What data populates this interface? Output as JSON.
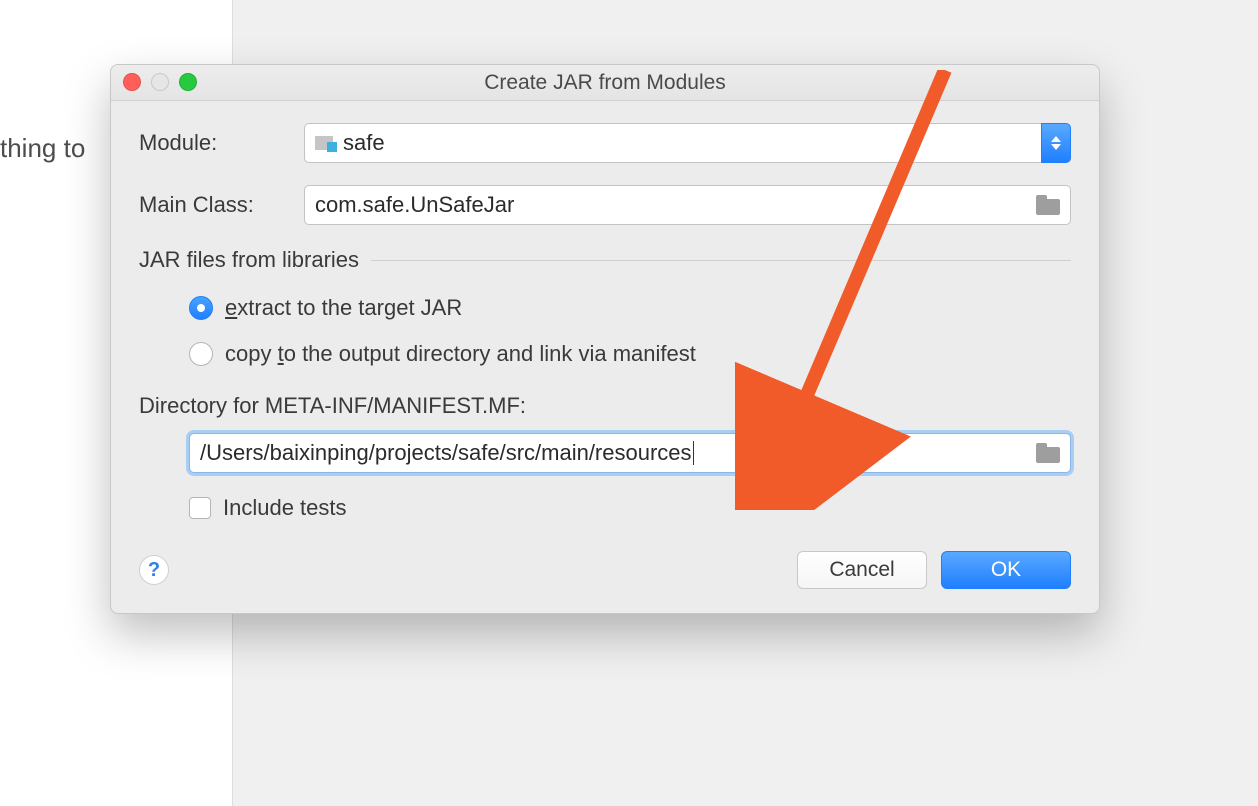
{
  "background": {
    "text_fragment": "thing to"
  },
  "dialog": {
    "title": "Create JAR from Modules",
    "module_label": "Module:",
    "module_value": "safe",
    "main_class_label": "Main Class:",
    "main_class_value": "com.safe.UnSafeJar",
    "group_title": "JAR files from libraries",
    "radio_extract": "extract to the target JAR",
    "radio_copy": "copy to the output directory and link via manifest",
    "dir_label": "Directory for META-INF/MANIFEST.MF:",
    "dir_value": "/Users/baixinping/projects/safe/src/main/resources",
    "include_tests": "Include tests",
    "cancel": "Cancel",
    "ok": "OK",
    "help": "?"
  }
}
